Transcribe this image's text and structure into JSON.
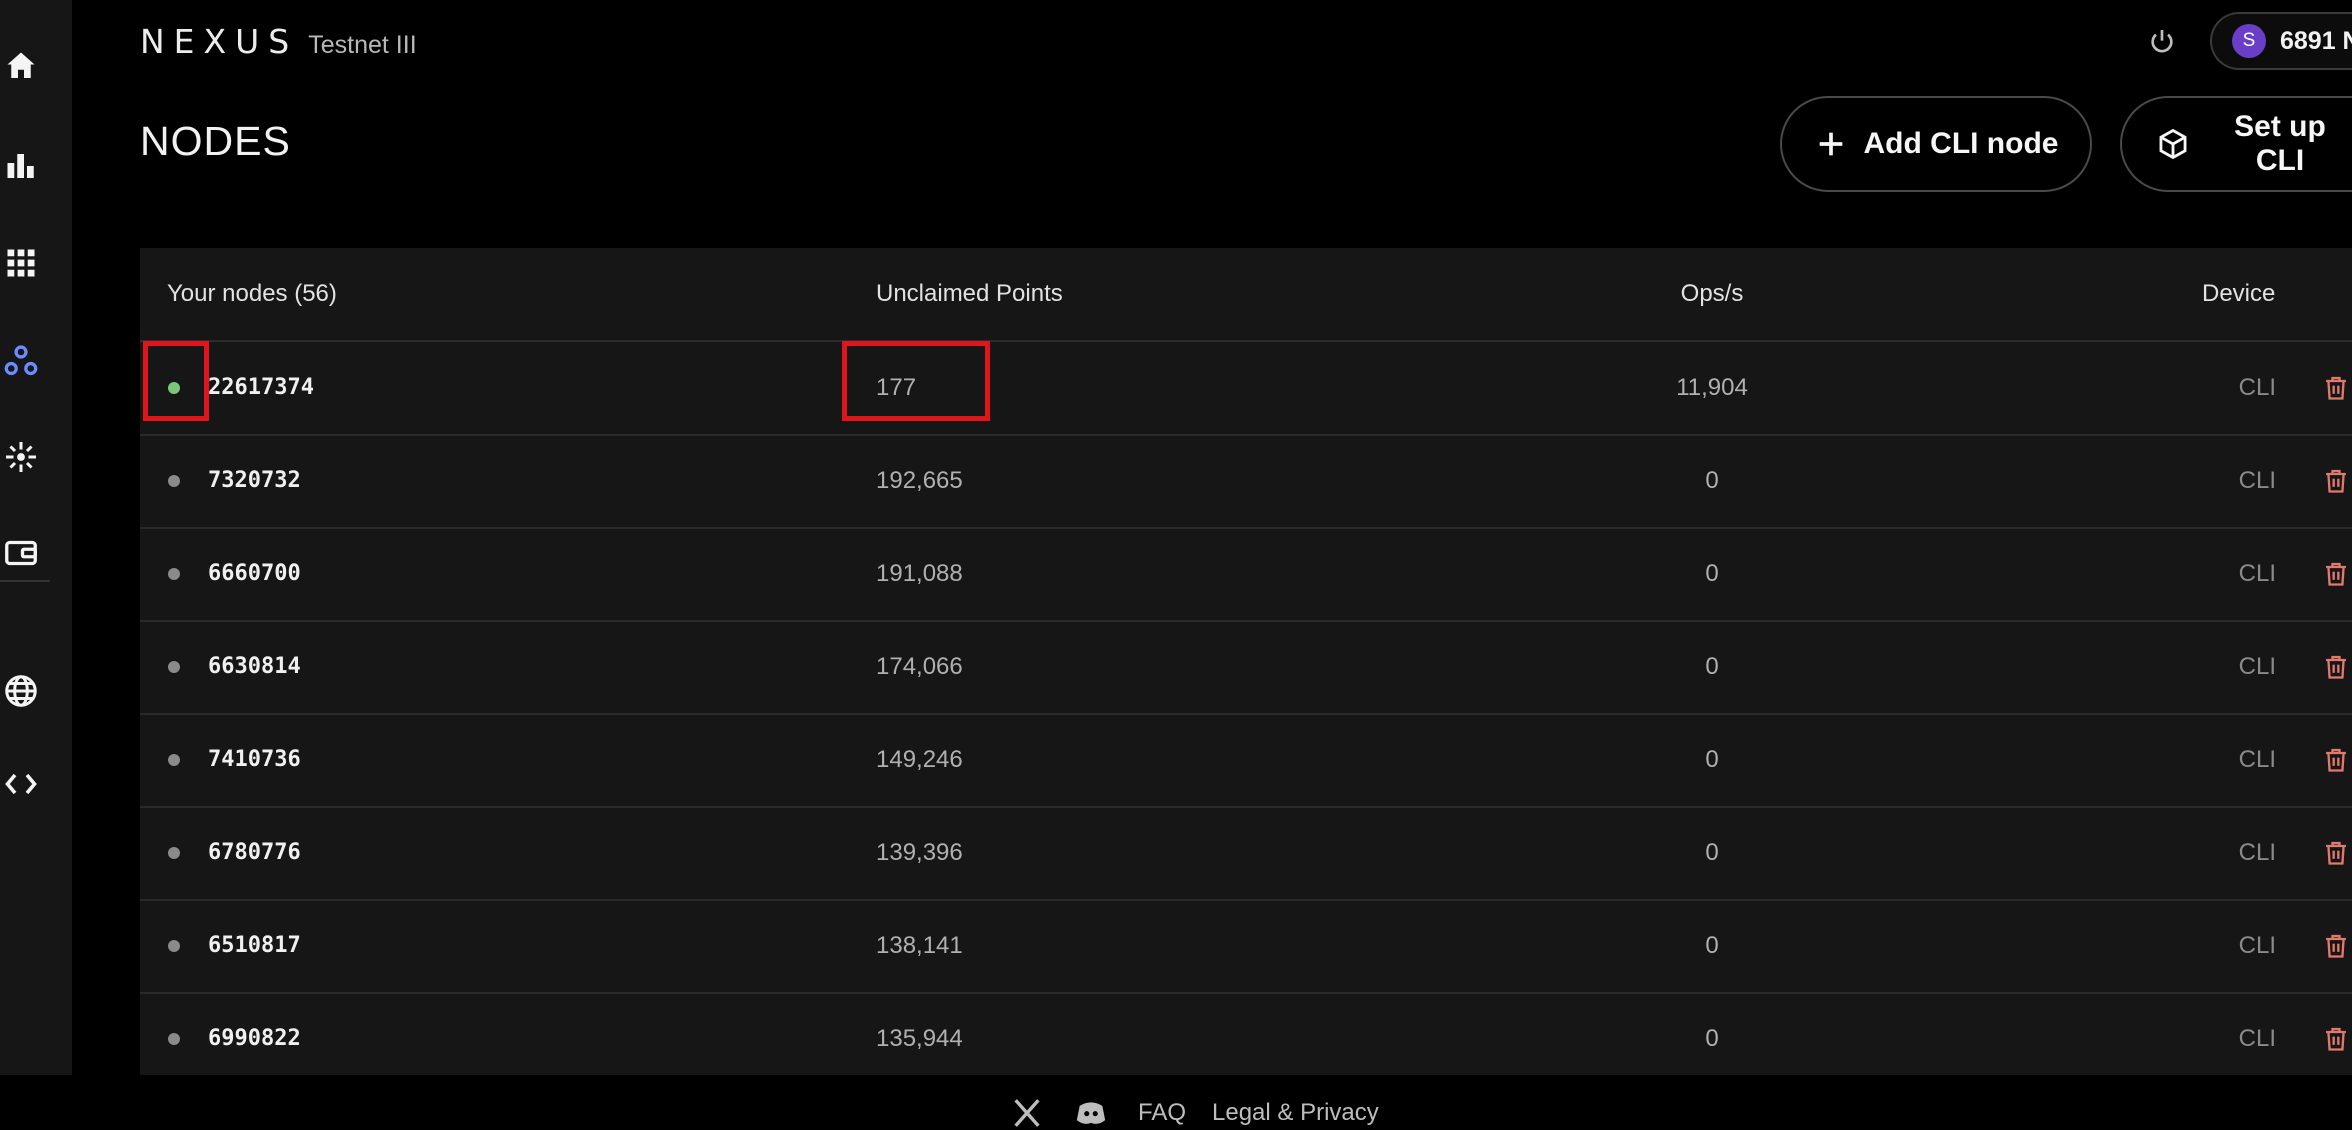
{
  "app": {
    "brand": "NEXUS",
    "network": "Testnet III"
  },
  "account": {
    "avatar_letter": "S",
    "label": "6891 N"
  },
  "page": {
    "title": "NODES"
  },
  "actions": {
    "add_cli_node": "Add CLI node",
    "set_up_cli": "Set up CLI"
  },
  "sidebar": {
    "items": [
      {
        "icon": "home-icon"
      },
      {
        "icon": "bar-chart-icon"
      },
      {
        "icon": "grid-icon"
      },
      {
        "icon": "nodes-icon",
        "active": true
      },
      {
        "icon": "sparkle-icon"
      },
      {
        "icon": "wallet-icon"
      },
      {
        "icon": "globe-icon"
      },
      {
        "icon": "code-icon"
      }
    ],
    "active_color": "#6b8cff"
  },
  "table": {
    "headers": {
      "nodes": "Your nodes (56)",
      "points": "Unclaimed Points",
      "ops": "Ops/s",
      "device": "Device"
    },
    "rows": [
      {
        "id": "22617374",
        "points": "177",
        "ops": "11,904",
        "device": "CLI",
        "status": "online"
      },
      {
        "id": "7320732",
        "points": "192,665",
        "ops": "0",
        "device": "CLI",
        "status": "offline"
      },
      {
        "id": "6660700",
        "points": "191,088",
        "ops": "0",
        "device": "CLI",
        "status": "offline"
      },
      {
        "id": "6630814",
        "points": "174,066",
        "ops": "0",
        "device": "CLI",
        "status": "offline"
      },
      {
        "id": "7410736",
        "points": "149,246",
        "ops": "0",
        "device": "CLI",
        "status": "offline"
      },
      {
        "id": "6780776",
        "points": "139,396",
        "ops": "0",
        "device": "CLI",
        "status": "offline"
      },
      {
        "id": "6510817",
        "points": "138,141",
        "ops": "0",
        "device": "CLI",
        "status": "offline"
      },
      {
        "id": "6990822",
        "points": "135,944",
        "ops": "0",
        "device": "CLI",
        "status": "offline"
      }
    ]
  },
  "colors": {
    "online": "#7bc67a",
    "offline": "#8a8a8a",
    "trash": "#e07a6e",
    "highlight": "#e0141c"
  },
  "footer": {
    "faq": "FAQ",
    "legal": "Legal & Privacy"
  }
}
